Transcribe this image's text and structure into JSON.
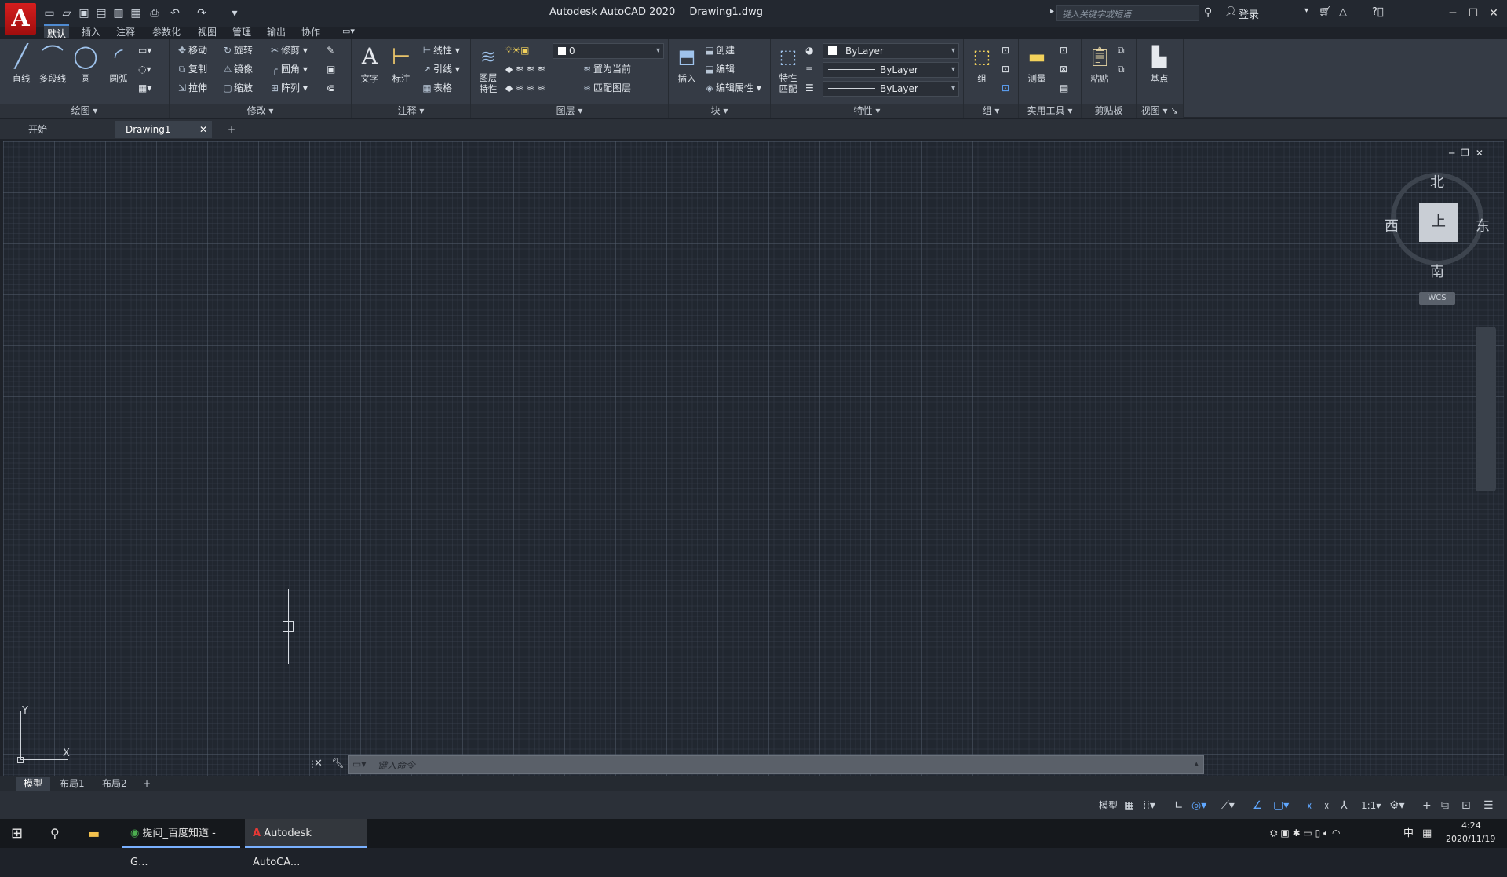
{
  "title_bar": {
    "app_logo_letter": "A",
    "app_name": "Autodesk AutoCAD 2020",
    "document": "Drawing1.dwg",
    "search_placeholder": "键入关键字或短语",
    "signin_label": "登录",
    "quick_access_icons": [
      "new-icon",
      "open-icon",
      "save-icon",
      "save-as-icon",
      "web-mobile-open-icon",
      "web-mobile-save-icon",
      "plot-icon",
      "undo-icon",
      "redo-icon",
      "customize-qat-icon"
    ],
    "window_controls": [
      "minimize",
      "maximize",
      "close"
    ]
  },
  "ribbon_tabs": [
    {
      "label": "默认",
      "active": true
    },
    {
      "label": "插入",
      "active": false
    },
    {
      "label": "注释",
      "active": false
    },
    {
      "label": "参数化",
      "active": false
    },
    {
      "label": "视图",
      "active": false
    },
    {
      "label": "管理",
      "active": false
    },
    {
      "label": "输出",
      "active": false
    },
    {
      "label": "协作",
      "active": false
    }
  ],
  "ribbon": {
    "draw": {
      "title": "绘图",
      "line": "直线",
      "polyline": "多段线",
      "circle": "圆",
      "arc": "圆弧"
    },
    "modify": {
      "title": "修改",
      "move": "移动",
      "rotate": "旋转",
      "trim": "修剪",
      "copy": "复制",
      "mirror": "镜像",
      "fillet": "圆角",
      "stretch": "拉伸",
      "scale": "缩放",
      "array": "阵列"
    },
    "annotation": {
      "title": "注释",
      "text": "文字",
      "dimension": "标注",
      "linear": "线性",
      "leader": "引线",
      "table": "表格"
    },
    "layers": {
      "title": "图层",
      "layer_properties": "图层\n特性",
      "current_layer": "0",
      "make_current": "置为当前",
      "match_layer": "匹配图层"
    },
    "block": {
      "title": "块",
      "insert": "插入",
      "create": "创建",
      "edit": "编辑",
      "edit_attributes": "编辑属性"
    },
    "properties": {
      "title": "特性",
      "match": "特性\n匹配",
      "color": "ByLayer",
      "linetype": "ByLayer",
      "lineweight": "ByLayer"
    },
    "groups": {
      "title": "组",
      "group": "组"
    },
    "utilities": {
      "title": "实用工具",
      "measure": "测量"
    },
    "clipboard": {
      "title": "剪贴板",
      "paste": "粘贴"
    },
    "view": {
      "title": "视图",
      "base": "基点"
    }
  },
  "doc_tabs": [
    {
      "label": "开始",
      "active": false
    },
    {
      "label": "Drawing1",
      "active": true
    }
  ],
  "viewcube": {
    "north": "北",
    "south": "南",
    "east": "东",
    "west": "西",
    "face": "上",
    "wcs": "WCS"
  },
  "ucs": {
    "x": "X",
    "y": "Y"
  },
  "command_line": {
    "placeholder": "键入命令"
  },
  "layout_tabs": [
    {
      "label": "模型",
      "active": true
    },
    {
      "label": "布局1",
      "active": false
    },
    {
      "label": "布局2",
      "active": false
    }
  ],
  "statusbar": {
    "model": "模型",
    "scale": "1:1"
  },
  "taskbar": {
    "chrome_title": "提问_百度知道 - G...",
    "autocad_title": "Autodesk AutoCA...",
    "ime": "中",
    "time": "4:24",
    "date": "2020/11/19"
  }
}
